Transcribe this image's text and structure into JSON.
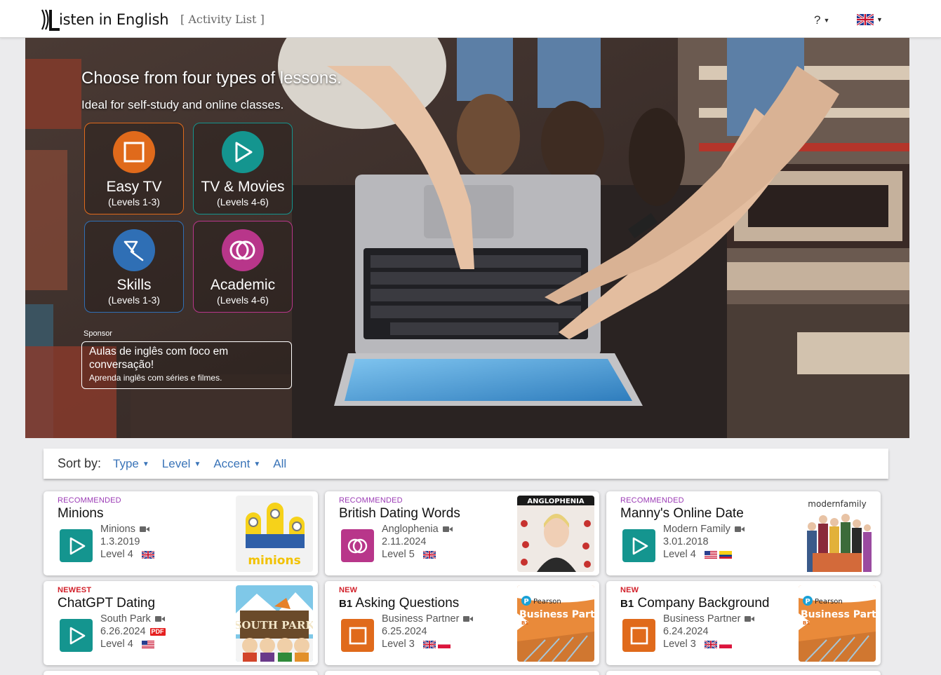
{
  "header": {
    "logo_text": "isten in English",
    "breadcrumb": "[ Activity List ]",
    "help_label": "?",
    "language_flag": "uk-flag-icon"
  },
  "hero": {
    "title": "Choose from four types of lessons.",
    "subtitle": "Ideal for self-study and online classes.",
    "lessons": [
      {
        "name": "Easy TV",
        "levels": "(Levels 1-3)",
        "color": "#e06a1b",
        "icon": "square-icon"
      },
      {
        "name": "TV & Movies",
        "levels": "(Levels 4-6)",
        "color": "#14958f",
        "icon": "play-icon"
      },
      {
        "name": "Skills",
        "levels": "(Levels 1-3)",
        "color": "#2f6fb5",
        "icon": "skills-icon"
      },
      {
        "name": "Academic",
        "levels": "(Levels 4-6)",
        "color": "#b8368a",
        "icon": "academic-icon"
      }
    ],
    "sponsor_label": "Sponsor",
    "sponsor": {
      "headline": "Aulas de inglês com foco em conversação!",
      "sub": "Aprenda inglês com séries e filmes."
    }
  },
  "sort": {
    "label": "Sort by:",
    "options": [
      "Type",
      "Level",
      "Accent",
      "All"
    ]
  },
  "colors": {
    "recommended": "#9b3bb5",
    "new": "#d2202a",
    "link": "#3a74b8",
    "tv_teal": "#14958f",
    "easy_orange": "#e06a1b",
    "academic_pink": "#b8368a"
  },
  "cards": [
    {
      "tag": "RECOMMENDED",
      "title": "Minions",
      "level_badge": "",
      "show": "Minions",
      "date": "1.3.2019",
      "level": "Level 4",
      "type_icon": "play-icon",
      "flags": [
        "uk-flag-icon"
      ],
      "pdf": "",
      "thumbnail": "minions-thumbnail",
      "thumb_text": "minions"
    },
    {
      "tag": "RECOMMENDED",
      "title": "British Dating Words",
      "level_badge": "",
      "show": "Anglophenia",
      "date": "2.11.2024",
      "level": "Level 5",
      "type_icon": "academic-icon",
      "flags": [
        "uk-flag-icon"
      ],
      "pdf": "",
      "thumbnail": "anglophenia-thumbnail",
      "thumb_text": "ANGLOPHENIA"
    },
    {
      "tag": "RECOMMENDED",
      "title": "Manny's Online Date",
      "level_badge": "",
      "show": "Modern Family",
      "date": "3.01.2018",
      "level": "Level 4",
      "type_icon": "play-icon",
      "flags": [
        "us-flag-icon",
        "colombia-flag-icon"
      ],
      "pdf": "",
      "thumbnail": "modern-family-thumbnail",
      "thumb_text": "modernfamily"
    },
    {
      "tag": "NEWEST",
      "title": "ChatGPT Dating",
      "level_badge": "",
      "show": "South Park",
      "date": "6.26.2024",
      "level": "Level 4",
      "type_icon": "play-icon",
      "flags": [
        "us-flag-icon"
      ],
      "pdf": "PDF",
      "thumbnail": "south-park-thumbnail",
      "thumb_text": "SOUTH PARK"
    },
    {
      "tag": "NEW",
      "title": "Asking Questions",
      "level_badge": "B1",
      "show": "Business Partner",
      "date": "6.25.2024",
      "level": "Level 3",
      "type_icon": "square-icon",
      "flags": [
        "uk-flag-icon",
        "poland-flag-icon"
      ],
      "pdf": "",
      "thumbnail": "business-partner-thumbnail",
      "thumb_text": "Business Partner"
    },
    {
      "tag": "NEW",
      "title": "Company Background",
      "level_badge": "B1",
      "show": "Business Partner",
      "date": "6.24.2024",
      "level": "Level 3",
      "type_icon": "square-icon",
      "flags": [
        "uk-flag-icon",
        "poland-flag-icon"
      ],
      "pdf": "",
      "thumbnail": "business-partner-thumbnail",
      "thumb_text": "Business Partner"
    }
  ]
}
